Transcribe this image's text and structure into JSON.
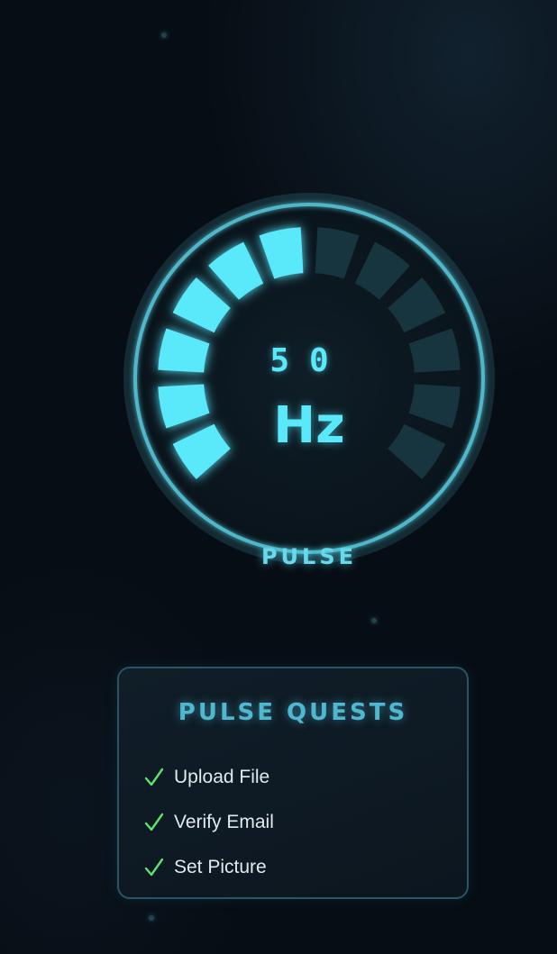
{
  "gauge": {
    "value": "50",
    "unit": "Hz",
    "label": "PULSE",
    "level": 0.5,
    "segments": 12,
    "active_color": "#5ae8fb",
    "inactive_color": "#16353f",
    "ring_color": "#4fb7c9"
  },
  "quests": {
    "title": "PULSE QUESTS",
    "check_color": "#5be36b",
    "items": [
      {
        "label": "Upload File",
        "icon": "check-icon",
        "done": true
      },
      {
        "label": "Verify Email",
        "icon": "check-icon",
        "done": true
      },
      {
        "label": "Set Picture",
        "icon": "check-icon",
        "done": true
      }
    ]
  }
}
